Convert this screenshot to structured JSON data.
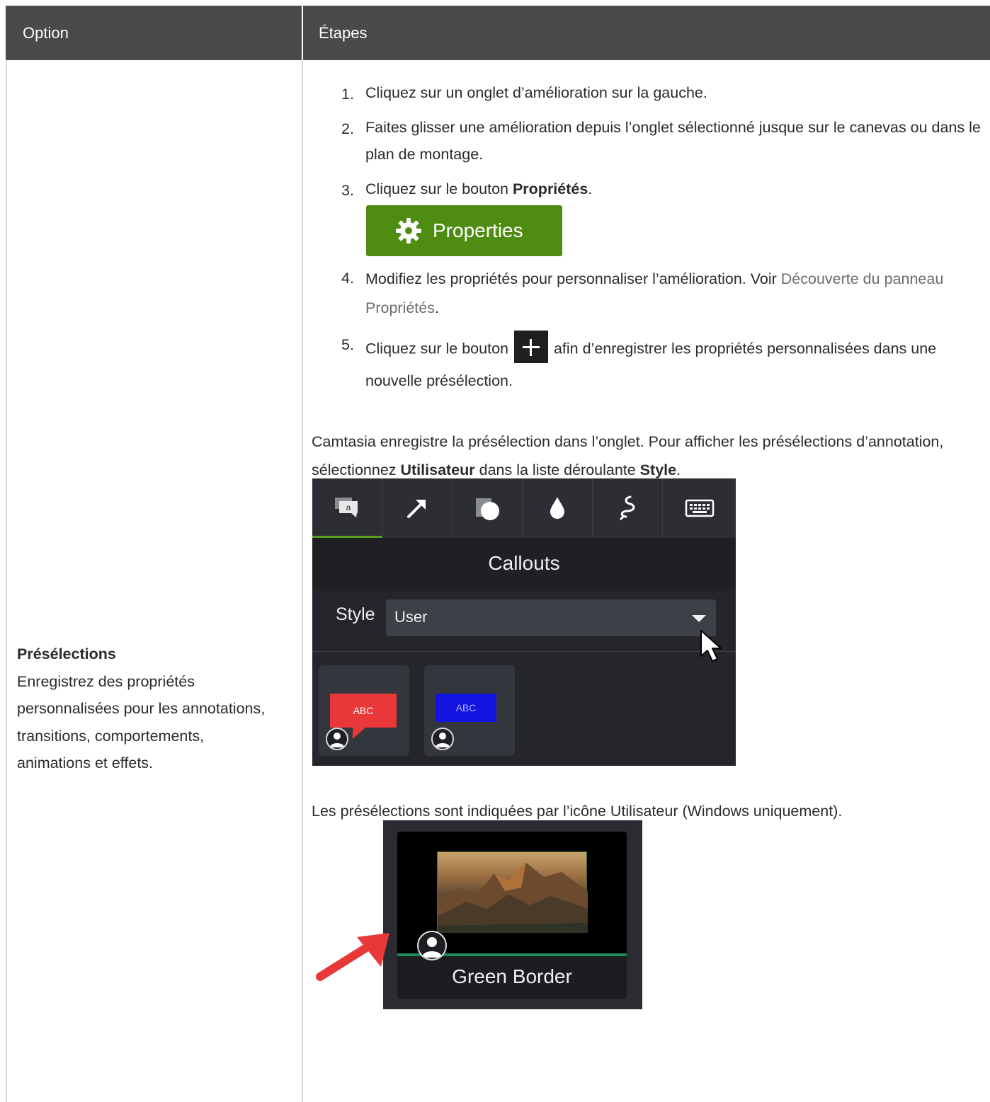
{
  "table": {
    "header": {
      "col1": "Option",
      "col2": "Étapes"
    }
  },
  "option": {
    "title": "Présélections",
    "description": "Enregistrez des propriétés personnalisées pour les annotations, transitions, comportements, animations et effets."
  },
  "steps": [
    {
      "num": "1.",
      "text": "Cliquez sur un onglet d’amélioration sur la gauche."
    },
    {
      "num": "2.",
      "text": "Faites glisser une amélioration depuis l’onglet sélectionné jusque sur le canevas ou dans le plan de montage."
    },
    {
      "num": "3.",
      "text_before": "Cliquez sur le bouton ",
      "bold": "Propriétés",
      "text_after": "."
    },
    {
      "num": "4.",
      "text_before": "Modifiez les propriétés pour personnaliser l’amélioration. Voir ",
      "link": "Découverte du panneau Propriétés",
      "text_after": "."
    },
    {
      "num": "5.",
      "text_before": "Cliquez sur le bouton ",
      "text_after": " afin d’enregistrer les propriétés personnalisées dans une nouvelle présélection."
    }
  ],
  "properties_button": {
    "label": "Properties"
  },
  "para1": {
    "before": "Camtasia enregistre la présélection dans l’onglet. Pour afficher les présélections d’annotation, sélectionnez ",
    "bold1": "Utilisateur",
    "middle": " dans la liste déroulante ",
    "bold2": "Style",
    "after": "."
  },
  "callouts_panel": {
    "tabs": [
      "callout-icon",
      "arrow-icon",
      "shape-icon",
      "blur-icon",
      "sketch-icon",
      "keyboard-icon"
    ],
    "title": "Callouts",
    "style_label": "Style",
    "style_value": "User",
    "presets": [
      {
        "text": "ABC",
        "color": "#e8383a"
      },
      {
        "text": "ABC",
        "color": "#1414e0"
      }
    ]
  },
  "para2": "Les présélections sont indiquées par l’icône Utilisateur (Windows uniquement).",
  "green_border_preset": {
    "label": "Green Border"
  }
}
